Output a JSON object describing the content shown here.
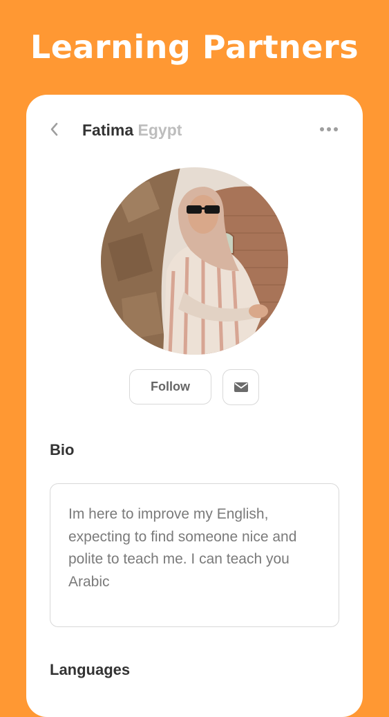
{
  "page": {
    "title": "Learning Partners"
  },
  "profile": {
    "name": "Fatima",
    "country": "Egypt",
    "avatar_icon": "profile-photo"
  },
  "header": {
    "back_icon": "chevron-left-icon",
    "more_icon": "more-horizontal-icon"
  },
  "actions": {
    "follow_label": "Follow",
    "message_icon": "envelope-icon"
  },
  "bio": {
    "title": "Bio",
    "text": "Im here to improve my English, expecting to find someone nice and polite to teach me. I can teach you Arabic"
  },
  "languages": {
    "title": "Languages"
  },
  "colors": {
    "background": "#FF9833",
    "card": "#FFFFFF",
    "text_primary": "#333333",
    "text_muted": "#BDBDBD",
    "border": "#D8D8D8"
  }
}
